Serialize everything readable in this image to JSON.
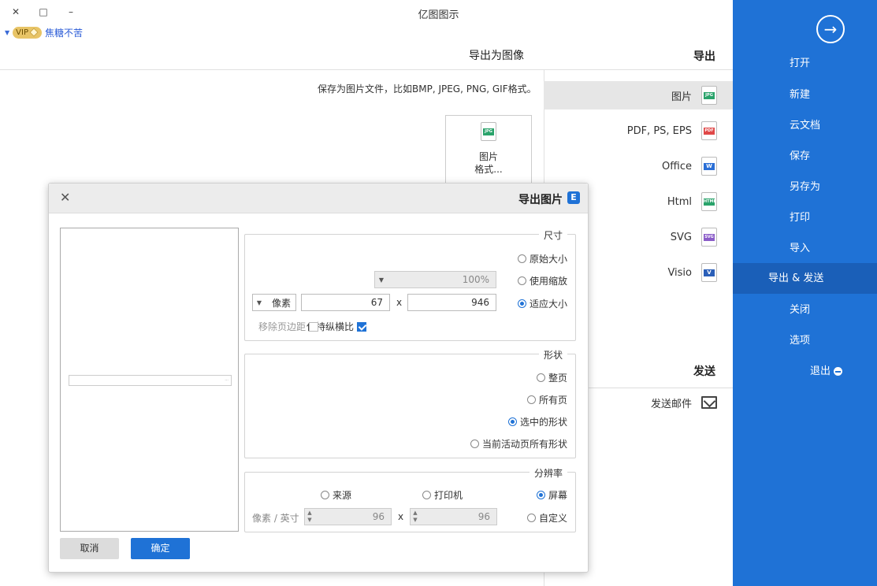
{
  "window": {
    "title": "亿图图示",
    "minimize": "–",
    "maximize": "□",
    "close": "✕"
  },
  "vip": {
    "user": "焦糖不苦",
    "badge": "VIP"
  },
  "sidebar": {
    "back": "→",
    "items": [
      {
        "label": "打开"
      },
      {
        "label": "新建"
      },
      {
        "label": "云文档"
      },
      {
        "label": "保存"
      },
      {
        "label": "另存为"
      },
      {
        "label": "打印"
      },
      {
        "label": "导入"
      },
      {
        "label": "导出 & 发送"
      },
      {
        "label": "关闭"
      },
      {
        "label": "选项"
      },
      {
        "label": "退出"
      }
    ],
    "active_index": 7
  },
  "export_panel": {
    "heading": "导出",
    "formats": [
      {
        "label": "图片",
        "tag": "JPG",
        "color": "#2aa36b"
      },
      {
        "label": "PDF, PS, EPS",
        "tag": "PDF",
        "color": "#e04848"
      },
      {
        "label": "Office",
        "tag": "W",
        "color": "#2b6fd6"
      },
      {
        "label": "Html",
        "tag": "HTML",
        "color": "#2aa36b"
      },
      {
        "label": "SVG",
        "tag": "SVG",
        "color": "#8a5cc8"
      },
      {
        "label": "Visio",
        "tag": "V",
        "color": "#2b5fb8"
      }
    ],
    "send_heading": "发送",
    "send_item": "发送邮件"
  },
  "main": {
    "heading": "导出为图像",
    "description": "保存为图片文件，比如BMP, JPEG, PNG, GIF格式。",
    "card_label_line1": "图片",
    "card_label_line2": "格式..."
  },
  "dialog": {
    "title": "导出图片",
    "logo": "E",
    "close": "✕",
    "size_group": {
      "title": "尺寸",
      "opt_original": "原始大小",
      "opt_zoom": "使用缩放",
      "zoom_value": "100%",
      "opt_fit": "适应大小",
      "width": "946",
      "x": "x",
      "height": "67",
      "unit": "像素",
      "remove_margin": "移除页边距",
      "keep_ratio": "保持纵横比",
      "selected": "fit",
      "keep_ratio_checked": true,
      "remove_margin_checked": false
    },
    "shape_group": {
      "title": "形状",
      "opt_whole": "整页",
      "opt_all": "所有页",
      "opt_selected": "选中的形状",
      "opt_current": "当前活动页所有形状",
      "selected": "selected"
    },
    "resolution_group": {
      "title": "分辨率",
      "opt_screen": "屏幕",
      "opt_printer": "打印机",
      "opt_source": "来源",
      "opt_custom": "自定义",
      "res_x": "96",
      "x": "x",
      "res_y": "96",
      "unit": "像素 / 英寸",
      "selected": "screen"
    },
    "ok": "确定",
    "cancel": "取消"
  }
}
